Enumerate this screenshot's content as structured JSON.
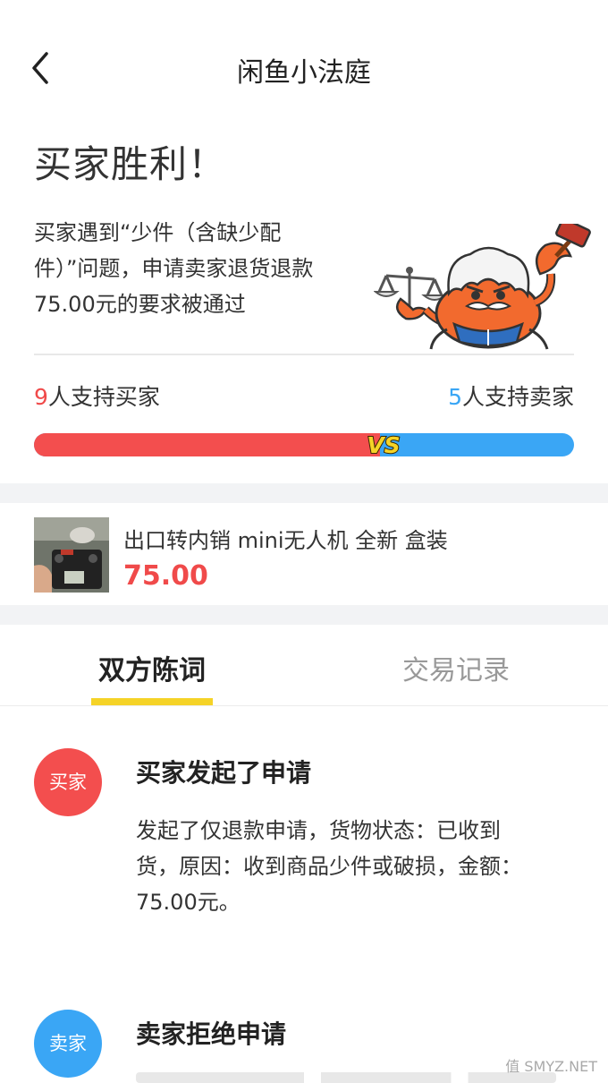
{
  "header": {
    "title": "闲鱼小法庭"
  },
  "verdict": {
    "title": "买家胜利！",
    "description_line1": "买家遇到“少件（含缺少配",
    "description_line2": "件）”问题，申请卖家退货退款",
    "description_line3": "75.00元的要求被通过"
  },
  "support": {
    "buyer_count": "9",
    "buyer_label": "人支持买家",
    "seller_count": "5",
    "seller_label": "人支持卖家",
    "buyer_fraction": 0.64,
    "vs_label": "VS"
  },
  "product": {
    "name": "出口转内销 mini无人机 全新 盒装",
    "price": "75.00"
  },
  "tabs": [
    {
      "label": "双方陈词",
      "active": true
    },
    {
      "label": "交易记录",
      "active": false
    }
  ],
  "timeline": [
    {
      "avatar": "买家",
      "title": "买家发起了申请",
      "body_line1": "发起了仅退款申请，货物状态：已收到",
      "body_line2": "货，原因：收到商品少件或破损，金额：",
      "body_line3": "75.00元。"
    },
    {
      "avatar": "卖家",
      "title": "卖家拒绝申请"
    }
  ],
  "watermark": "值 SMYZ.NET",
  "colors": {
    "buyer": "#f34e4e",
    "seller": "#3aa6f5",
    "accent": "#f5d327"
  }
}
